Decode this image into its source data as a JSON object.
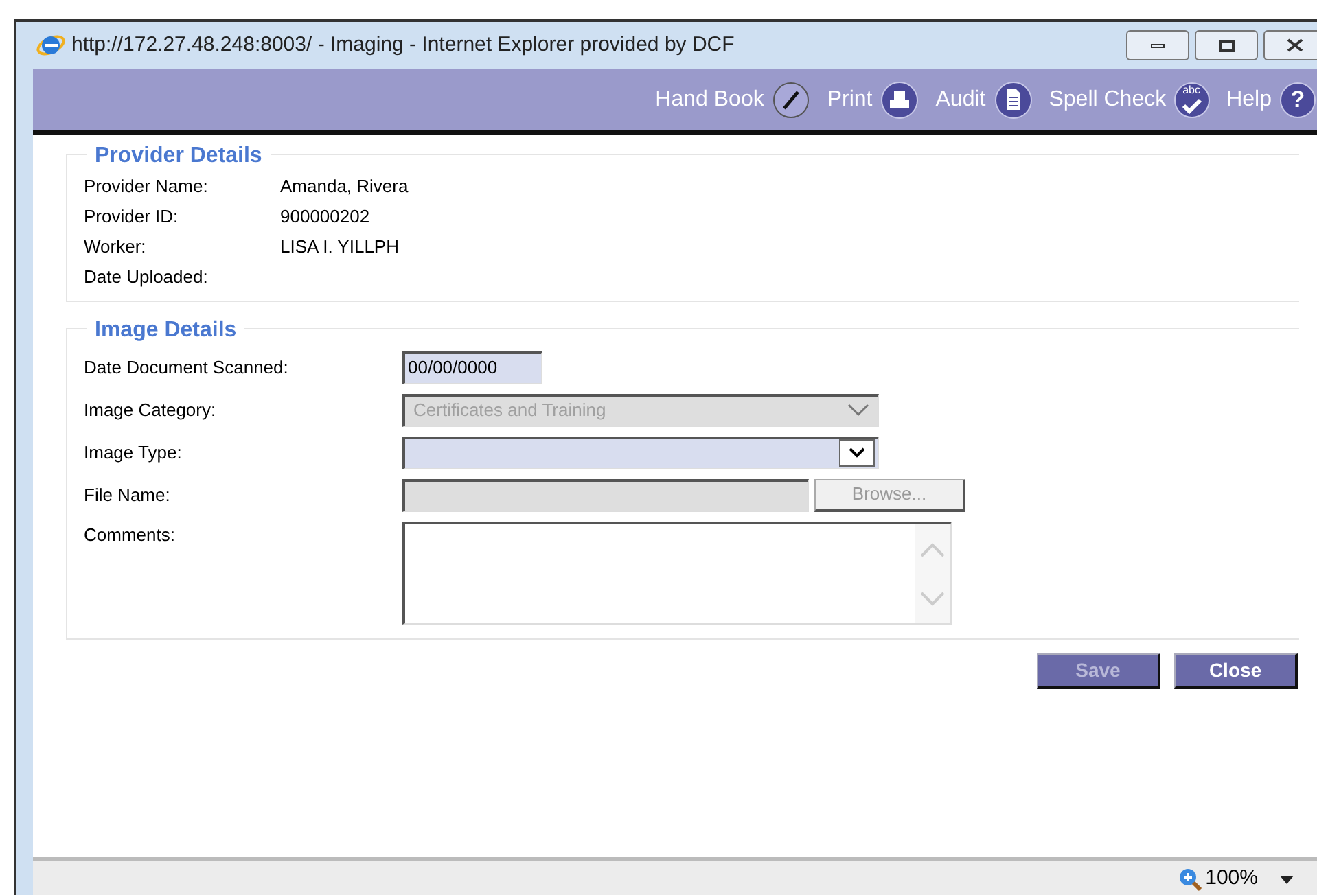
{
  "window": {
    "title": "http://172.27.48.248:8003/ - Imaging - Internet Explorer provided by DCF"
  },
  "toolbar": [
    {
      "label": "Hand Book",
      "kind": "pencil"
    },
    {
      "label": "Print",
      "kind": "printer"
    },
    {
      "label": "Audit",
      "kind": "document"
    },
    {
      "label": "Spell Check",
      "kind": "spellcheck",
      "icon_text": "abc"
    },
    {
      "label": "Help",
      "kind": "help",
      "icon_text": "?"
    }
  ],
  "provider_details": {
    "title": "Provider Details",
    "fields": [
      {
        "label": "Provider Name:",
        "value": "Amanda, Rivera"
      },
      {
        "label": "Provider ID:",
        "value": "900000202"
      },
      {
        "label": "Worker:",
        "value": "LISA I. YILLPH"
      },
      {
        "label": "Date Uploaded:"
      }
    ]
  },
  "image_details": {
    "title": "Image Details",
    "fields": [
      {
        "kind": "text",
        "label": "Date Document Scanned:",
        "value": "00/00/0000",
        "disabled": false
      },
      {
        "kind": "select",
        "label": "Image Category:",
        "value": "Certificates and Training",
        "disabled": true
      },
      {
        "kind": "select",
        "label": "Image Type:",
        "disabled": false
      },
      {
        "kind": "file",
        "label": "File Name:",
        "button": "Browse...",
        "disabled": true
      },
      {
        "kind": "textarea",
        "label": "Comments:",
        "disabled": false
      }
    ]
  },
  "buttons": [
    {
      "label": "Save",
      "disabled": true
    },
    {
      "label": "Close",
      "disabled": false
    }
  ],
  "status_bar": {
    "zoom": "100%"
  }
}
